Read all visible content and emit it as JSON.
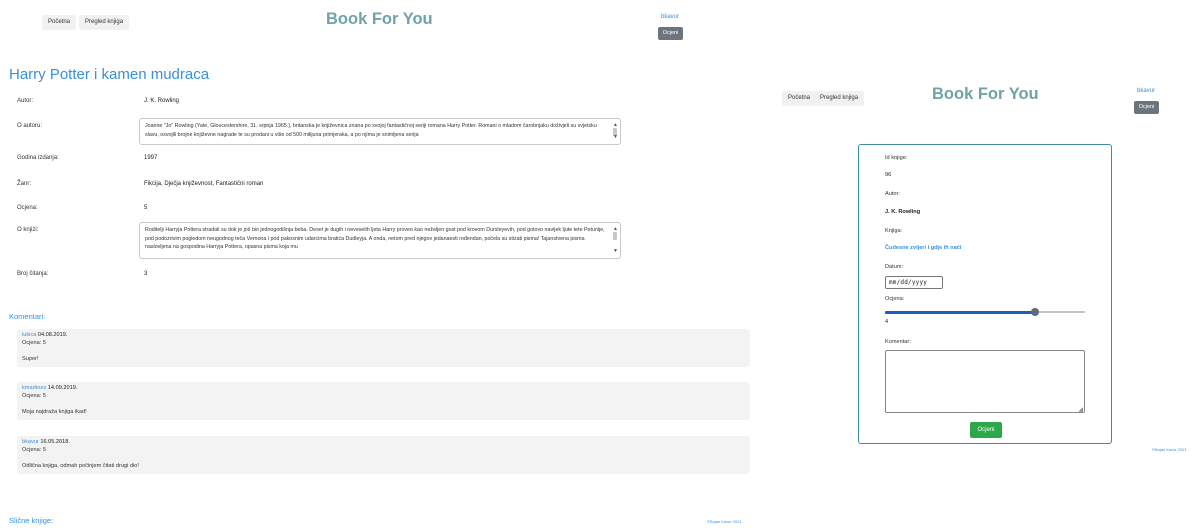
{
  "left_page": {
    "nav": {
      "home": "Početna",
      "browse": "Pregled knjiga",
      "brand": "Book For You",
      "user": "bkavur",
      "rate_button": "Ocjeni"
    },
    "book": {
      "title": "Harry Potter i kamen mudraca",
      "fields": [
        {
          "label": "Autor:",
          "value": "J. K. Rowling"
        },
        {
          "label": "O autoru:",
          "value": "Joanne \"Jo\" Rowling (Yate, Gloucestershire, 31. srpnja 1965.), britanska je književnica znana po svojoj fantastičnoj seriji romana Harry Potter. Romani o mladom čarobnjaku doživjeli su svjetsku slavu, osvojili brojne književne nagrade te su prodani u više od 500 milijuna primjeraka, a po njima je snimljena serija"
        },
        {
          "label": "Godina izdanja:",
          "value": "1997"
        },
        {
          "label": "Žanr:",
          "value": "Fikcija, Dječja književnost, Fantastični roman"
        },
        {
          "label": "Ocjena:",
          "value": "5"
        },
        {
          "label": "O knjizi:",
          "value": "Roditelji Harryja Pottera stradali su dok je još bio jednogodišnja beba. Deset je dugih i neveselih ljeta Harry proveo kao neželjen gost pod krovom Dursleyevih, pod gotovo navijek ljute tete Petunije, pod podozrivim pogledom neugodnog teča Vernona i pod pakosnim udarcima bratića Dudleyja. A onda, netom pred njegov jedanaesti rođendan, počela su stizati pisma! Tajanstvena pisma naslovljena na gospodina Harryja Pottera, opasna pisma koja mu"
        },
        {
          "label": "Broj čitanja:",
          "value": "3"
        }
      ]
    },
    "comments_heading": "Komentari:",
    "comments": [
      {
        "user": "lukica",
        "date": "04.08.2019.",
        "rating": "Ocjena: 5",
        "text": "Super!"
      },
      {
        "user": "kmartinez",
        "date": "14.09.2019.",
        "rating": "Ocjena: 5",
        "text": "Moja najdraža knjiga ikad!"
      },
      {
        "user": "bkavur",
        "date": "16.05.2018.",
        "rating": "Ocjena: 5",
        "text": "Odlična knjiga, odmah počinjem čitati drugi dio!"
      }
    ],
    "similar_heading": "Slične knjige:",
    "footer": "©Bojan Kavur 2021"
  },
  "right_page": {
    "nav": {
      "home": "Početna",
      "browse": "Pregled knjiga",
      "brand": "Book For You",
      "user": "bkavur",
      "rate_button": "Ocjeni"
    },
    "form": {
      "book_id_label": "Id knjige:",
      "book_id_value": "96",
      "author_label": "Autor:",
      "author_value": "J. K. Rowling",
      "book_label": "Knjiga:",
      "book_value": "Čudesne zvijeri i gdje ih naći",
      "date_label": "Datum:",
      "date_placeholder": "mm/dd/yyyy",
      "rating_label": "Ocjena:",
      "rating_value": "4",
      "rating_fraction": 0.75,
      "comment_label": "Komentar:",
      "submit_label": "Ocjeni"
    },
    "footer": "©Bojan Kavur 2021"
  },
  "colors": {
    "accent": "#3a8fd9",
    "brand": "#6fa3a8",
    "card_border": "#3c8f99",
    "submit": "#2ba84a",
    "dark_button": "#6c757d"
  }
}
